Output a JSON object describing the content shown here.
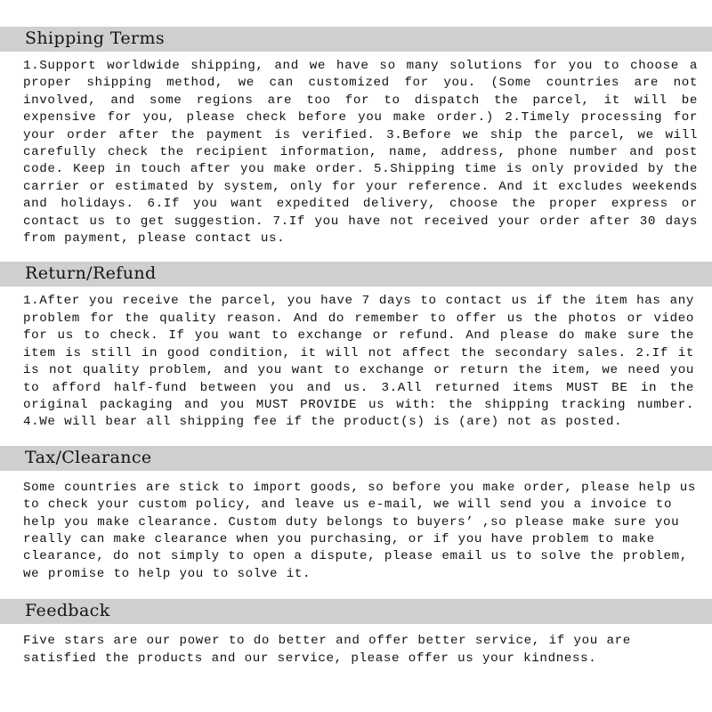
{
  "document": {
    "type": "policy-terms",
    "background_color": "#ffffff",
    "header_band_color": "#cfcfcf",
    "text_color": "#121212"
  },
  "sections": [
    {
      "id": "shipping-terms",
      "title": "Shipping Terms",
      "body": "1.Support worldwide shipping, and we have so many solutions for you to choose a proper shipping method, we can customized for you. (Some countries are not involved, and some regions are too for to dispatch the parcel, it will be expensive for you, please check before you make order.) 2.Timely processing for your order after the payment is verified. 3.Before we ship the parcel, we will carefully check the recipient information, name, address, phone number and post code. Keep in touch after you make order. 5.Shipping time is only provided by the carrier or estimated by system, only for your reference. And it excludes weekends and holidays. 6.If you want expedited delivery, choose the proper express or contact us to get suggestion. 7.If you have not received your order after 30 days from payment, please contact us."
    },
    {
      "id": "return-refund",
      "title": "Return/Refund",
      "body": "1.After you receive the parcel, you have 7 days to contact us if the item has any problem for the quality reason. And do remember to offer us the photos or video for us to check. If you want to exchange or refund. And please do make sure the item is still in good condition, it will not affect the secondary sales. 2.If it is not quality problem, and you want to exchange or return the item, we need you to afford half-fund between you and us. 3.All returned items MUST BE in the original packaging and you MUST PROVIDE us with: the shipping tracking number. 4.We will bear all shipping fee if the product(s) is (are) not as posted."
    },
    {
      "id": "tax-clearance",
      "title": "Tax/Clearance",
      "body": "Some countries are stick to import goods, so before you make order, please help us to check your custom policy, and leave us e-mail, we will send you a invoice to help you make clearance. Custom duty belongs to buyers’ ,so please make sure you really can make clearance when you purchasing, or if you have problem to make clearance, do not simply to open a dispute, please email us to solve the problem, we promise to help you to solve it."
    },
    {
      "id": "feedback",
      "title": "Feedback",
      "body": "Five stars are our power to do better and offer better service, if you are satisfied the products and our service, please offer us your kindness."
    }
  ]
}
